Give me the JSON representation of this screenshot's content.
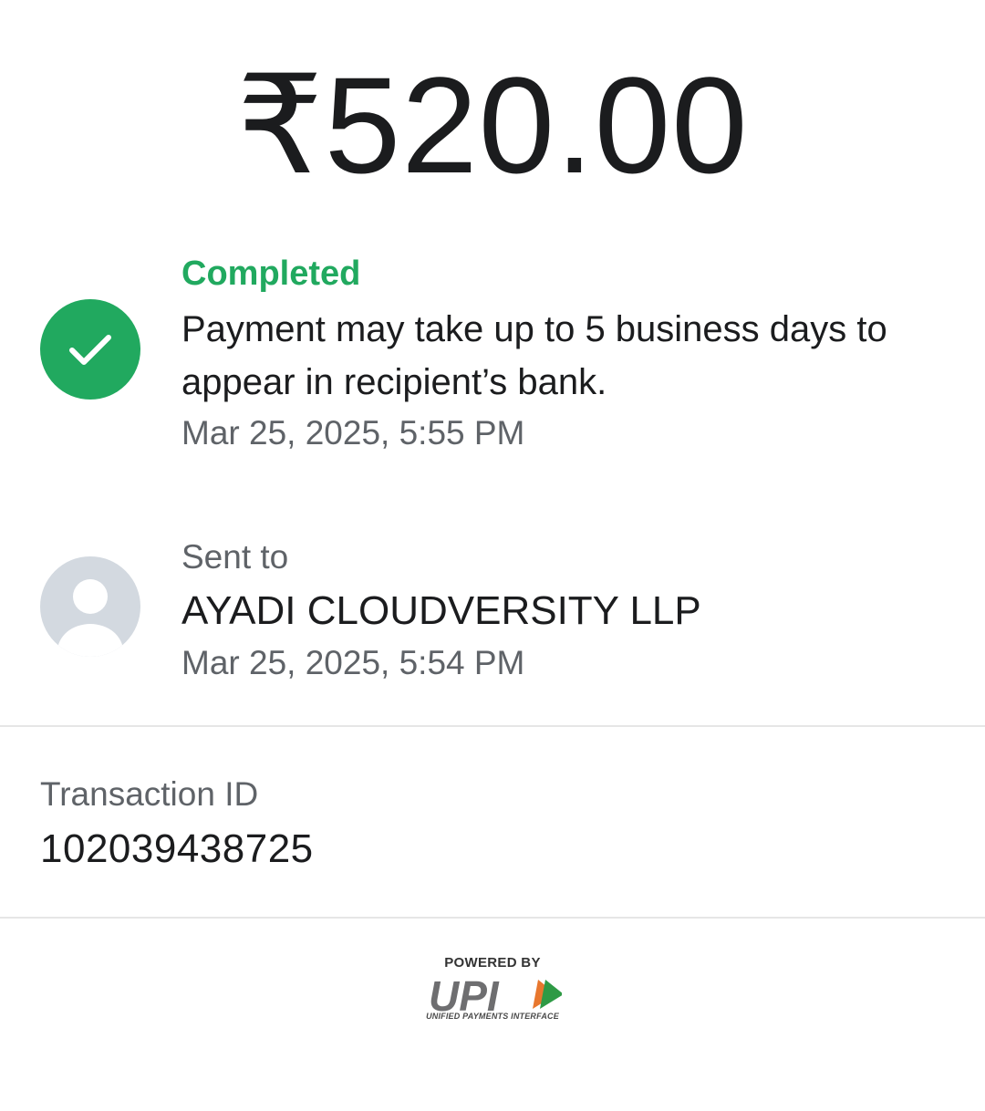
{
  "amount": "₹520.00",
  "status": {
    "label": "Completed",
    "message": "Payment may take up to 5 business days to appear in recipient’s bank.",
    "timestamp": "Mar 25, 2025, 5:55 PM",
    "icon": "check-circle-icon",
    "color": "#21a95f"
  },
  "recipient": {
    "label": "Sent to",
    "name": "AYADI CLOUDVERSITY LLP",
    "timestamp": "Mar 25, 2025, 5:54 PM",
    "icon": "person-avatar-icon"
  },
  "transaction": {
    "label": "Transaction ID",
    "value": "102039438725"
  },
  "footer": {
    "powered_by": "POWERED BY",
    "logo_text": "UPI",
    "subtitle": "UNIFIED PAYMENTS INTERFACE"
  }
}
